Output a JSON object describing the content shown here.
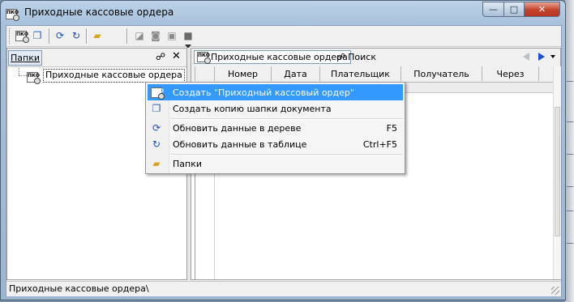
{
  "window": {
    "title": "Приходные кассовые ордера",
    "min_glyph": "—",
    "max_glyph": "□",
    "close_glyph": "✕"
  },
  "app_icon_text": "ПКО",
  "toolbar": {
    "icons": [
      "new-doc-icon",
      "copy-doc-icon",
      "refresh-tree-icon",
      "refresh-table-icon",
      "folder-icon",
      "eraser-icon",
      "stamp-icon",
      "clear-icon",
      "delete-icon"
    ]
  },
  "left_pane": {
    "tab_label": "Папки",
    "close_glyph": "✕",
    "tree": [
      {
        "label": "Приходные кассовые ордера",
        "icon": "pko-icon"
      }
    ]
  },
  "right_pane": {
    "tabs": [
      {
        "label": "Приходные кассовые ордера",
        "active": true,
        "icon": "pko-icon"
      },
      {
        "label": "Поиск",
        "active": false,
        "icon": "binoculars-icon"
      }
    ],
    "columns": [
      "",
      "Номер",
      "Дата",
      "Плательщик",
      "Получатель",
      "Через"
    ]
  },
  "context_menu": {
    "items": [
      {
        "label": "Создать \"Приходный кассовый ордер\"",
        "shortcut": "",
        "icon": "pko-icon",
        "selected": true
      },
      {
        "label": "Создать копию шапки документа",
        "shortcut": "",
        "icon": "copy-doc-icon",
        "selected": false
      },
      {
        "label": "Обновить данные в дереве",
        "shortcut": "F5",
        "icon": "refresh-tree-icon",
        "selected": false
      },
      {
        "label": "Обновить данные в таблице",
        "shortcut": "Ctrl+F5",
        "icon": "refresh-table-icon",
        "selected": false
      },
      {
        "label": "Папки",
        "shortcut": "",
        "icon": "folder-icon",
        "selected": false
      }
    ]
  },
  "status_bar": {
    "path": "Приходные кассовые ордера\\"
  },
  "colors": {
    "selection": "#3399ff",
    "close_button": "#c4432d",
    "nav_active": "#1a4fd6"
  }
}
